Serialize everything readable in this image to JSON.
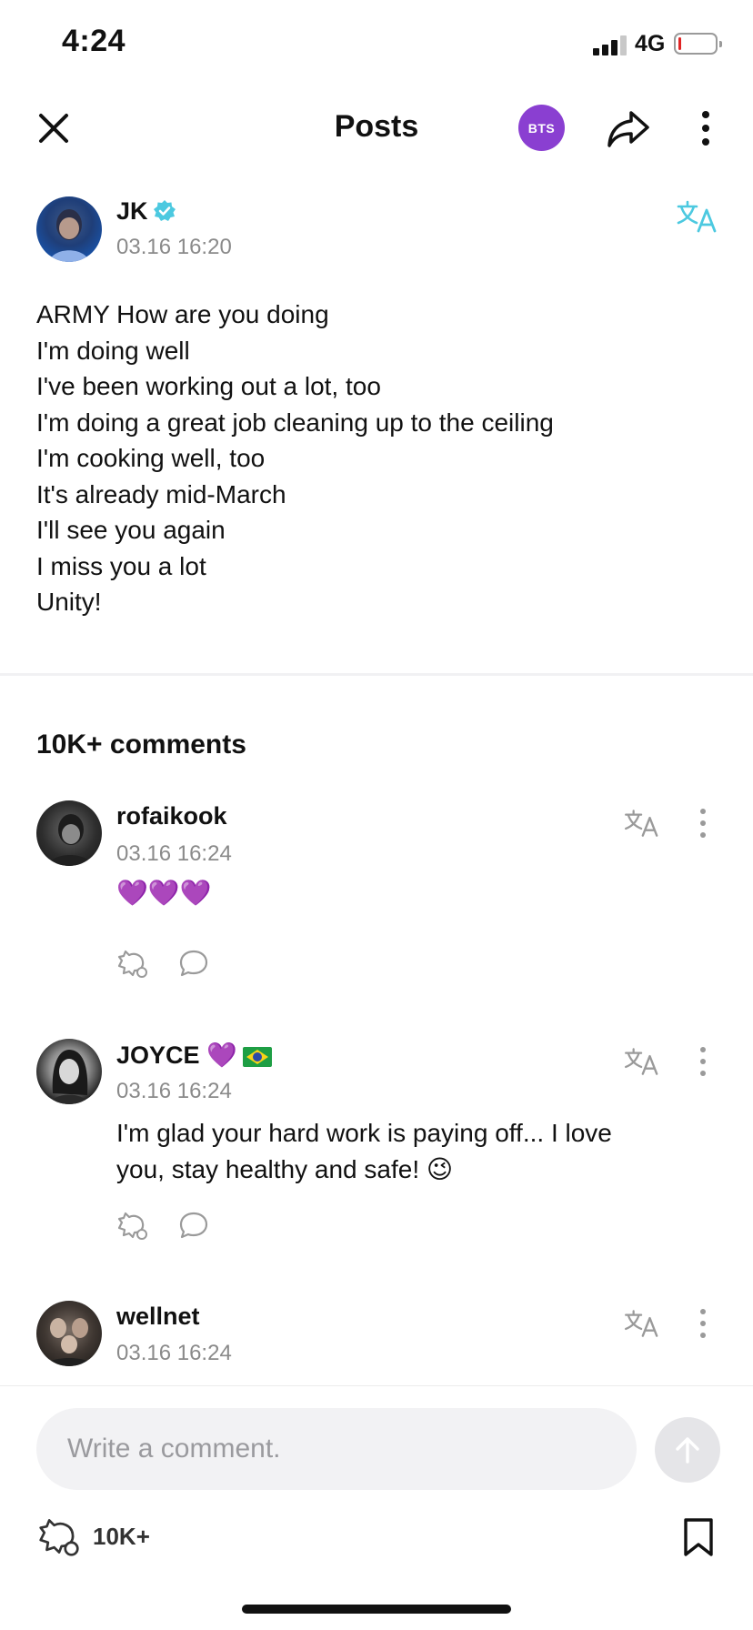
{
  "status_bar": {
    "time": "4:24",
    "network": "4G",
    "battery_level": 0.08
  },
  "header": {
    "title": "Posts",
    "community_badge": "BTS"
  },
  "post": {
    "author": "JK",
    "timestamp": "03.16 16:20",
    "lines": [
      "ARMY How are you doing",
      "I'm doing well",
      "I've been working out a lot, too",
      "I'm doing a great job cleaning up to the ceiling",
      "I'm cooking well, too",
      "It's already mid-March",
      "I'll see you again",
      "I miss you a lot",
      "Unity!"
    ]
  },
  "comments_section": {
    "title": "10K+ comments",
    "items": [
      {
        "user": "rofaikook",
        "timestamp": "03.16 16:24",
        "text": "💜💜💜"
      },
      {
        "user": "JOYCE 💜",
        "timestamp": "03.16 16:24",
        "text_lines": [
          "I'm glad your hard work is paying off... I love",
          "you, stay healthy and safe! 😉"
        ]
      },
      {
        "user": "wellnet",
        "timestamp": "03.16 16:24"
      }
    ]
  },
  "composer": {
    "placeholder": "Write a comment.",
    "reaction_count": "10K+"
  },
  "colors": {
    "accent_purple": "#8a3fd1",
    "verified": "#4cc9e0",
    "translate_active": "#4cc9e0",
    "muted": "#8a8a8a"
  }
}
